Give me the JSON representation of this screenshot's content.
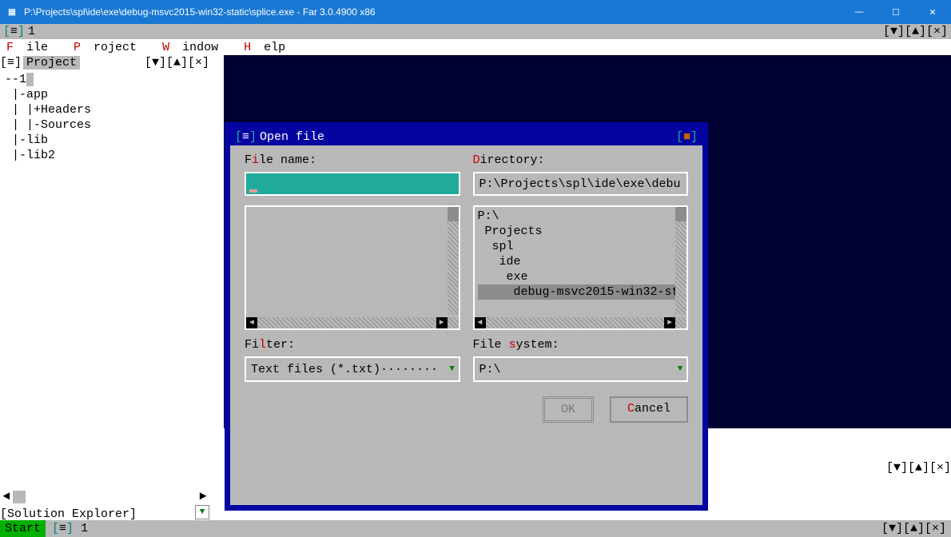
{
  "window": {
    "title": "P:\\Projects\\spl\\ide\\exe\\debug-msvc2015-win32-static\\splice.exe - Far 3.0.4900 x86",
    "minimize": "—",
    "maximize": "☐",
    "close": "✕"
  },
  "topTab": {
    "sym": "≡",
    "num": "1",
    "ctrls": "[▼][▲][×]"
  },
  "menu": {
    "file": "ile",
    "project": "roject",
    "window": "indow",
    "help": "elp",
    "hot_f": "F",
    "hot_p": "P",
    "hot_w": "W",
    "hot_h": "H"
  },
  "sidebar": {
    "head_sym": "≡",
    "head_label": "Project",
    "head_ctrls": "[▼][▲][×]",
    "tree": [
      "--1",
      " |-app",
      " | |+Headers",
      " | |-Sources",
      " |-lib",
      " |-lib2"
    ],
    "scroll_left": "◄",
    "scroll_right": "►",
    "footer_label": "[Solution Explorer",
    "footer_ctrls": "]",
    "drop": "▼"
  },
  "main": {
    "tab_ctrls": "[▼][▲][×]"
  },
  "dialog": {
    "head_sym": "≡",
    "title": "Open file",
    "close": "■",
    "filename_label_pre": "F",
    "filename_label_hot": "i",
    "filename_label_post": "le name:",
    "directory_label_hot": "D",
    "directory_label_post": "irectory:",
    "directory_value": "P:\\Projects\\spl\\ide\\exe\\debu",
    "dir_tree": [
      "P:\\",
      " Projects",
      "  spl",
      "   ide",
      "    exe"
    ],
    "dir_tree_sel": "     debug-msvc2015-win32-st",
    "filter_label_pre": "Fi",
    "filter_label_hot": "l",
    "filter_label_post": "ter:",
    "filesystem_label_pre": "File ",
    "filesystem_label_hot": "s",
    "filesystem_label_post": "ystem:",
    "filter_value": "Text files (*.txt)········",
    "filesystem_value": "P:\\",
    "ok": "OK",
    "cancel_hot": "C",
    "cancel_rest": "ancel",
    "arrow_left": "◄",
    "arrow_right": "►",
    "arrow_down": "▼"
  },
  "status": {
    "start": "Start",
    "sym": "≡",
    "num": "1",
    "ctrls": "[▼][▲][×]"
  }
}
